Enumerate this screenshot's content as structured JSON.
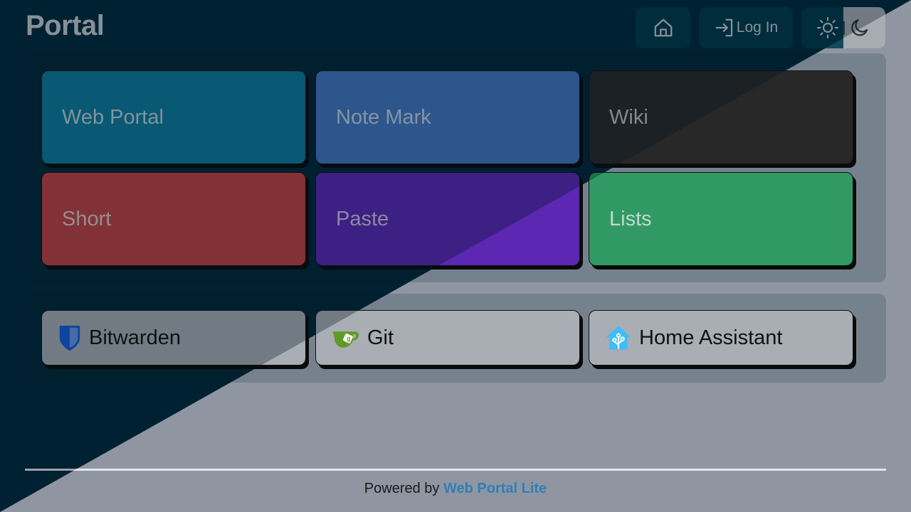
{
  "header": {
    "title": "Portal",
    "login_label": "Log In",
    "theme_separator": "|"
  },
  "links": [
    {
      "label": "Web Portal",
      "color": "#0e7a9c"
    },
    {
      "label": "Note Mark",
      "color": "#4276c0"
    },
    {
      "label": "Wiki",
      "color": "#282828"
    },
    {
      "label": "Short",
      "color": "#c04242"
    },
    {
      "label": "Paste",
      "color": "#5b27b3"
    },
    {
      "label": "Lists",
      "color": "#319a64"
    }
  ],
  "apps": [
    {
      "label": "Bitwarden",
      "icon": "bitwarden-shield-icon"
    },
    {
      "label": "Git",
      "icon": "gitea-teacup-icon"
    },
    {
      "label": "Home Assistant",
      "icon": "home-assistant-icon"
    }
  ],
  "footer": {
    "prefix": "Powered by",
    "link": "Web Portal Lite"
  }
}
